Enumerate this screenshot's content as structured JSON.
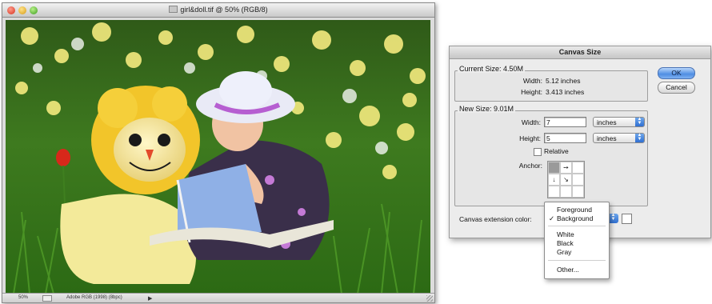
{
  "document": {
    "title": "girl&doll.tif @ 50% (RGB/8)",
    "status_zoom": "50%",
    "status_profile": "Adobe RGB (1998) (8bpc)"
  },
  "dialog": {
    "title": "Canvas Size",
    "current_size": {
      "label": "Current Size: 4.50M",
      "width_label": "Width:",
      "width_value": "5.12 inches",
      "height_label": "Height:",
      "height_value": "3.413 inches"
    },
    "new_size": {
      "label": "New Size: 9.01M",
      "width_label": "Width:",
      "width_value": "7",
      "width_unit": "inches",
      "height_label": "Height:",
      "height_value": "5",
      "height_unit": "inches",
      "relative_label": "Relative",
      "relative_checked": false,
      "anchor_label": "Anchor:"
    },
    "canvas_extension_label": "Canvas extension color:",
    "ok_label": "OK",
    "cancel_label": "Cancel"
  },
  "extension_menu": {
    "items": [
      {
        "label": "Foreground",
        "checked": false
      },
      {
        "label": "Background",
        "checked": true
      },
      {
        "label": "White",
        "checked": false
      },
      {
        "label": "Black",
        "checked": false
      },
      {
        "label": "Gray",
        "checked": false
      },
      {
        "label": "Other...",
        "checked": false
      }
    ],
    "check_glyph": "✓"
  }
}
